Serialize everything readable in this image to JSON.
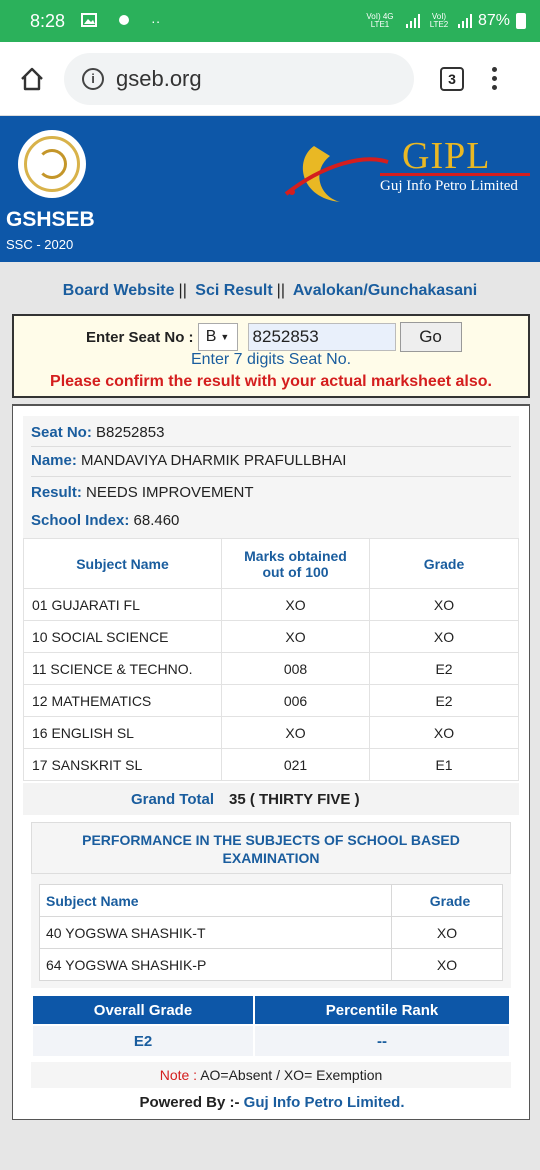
{
  "status_bar": {
    "time": "8:28",
    "signal1_label": "VoI) 4G LTE1",
    "signal2_label": "VoI) LTE2",
    "battery": "87%"
  },
  "browser": {
    "url": "gseb.org",
    "tab_count": "3"
  },
  "header": {
    "board_name": "GSHSEB",
    "exam": "SSC - 2020",
    "partner_title": "GIPL",
    "partner_subtitle": "Guj Info Petro Limited"
  },
  "links": [
    {
      "label": "Board Website"
    },
    {
      "label": "Sci Result"
    },
    {
      "label": "Avalokan/Gunchakasani"
    }
  ],
  "seat_form": {
    "label": "Enter Seat No :",
    "series_value": "B",
    "seat_value": "8252853",
    "go_label": "Go",
    "hint": "Enter 7 digits Seat No.",
    "warning": "Please confirm the result with your actual marksheet also."
  },
  "result": {
    "seat_no_label": "Seat No:",
    "seat_no": "B8252853",
    "name_label": "Name:",
    "name": "MANDAVIYA DHARMIK PRAFULLBHAI",
    "result_label": "Result:",
    "result": "NEEDS IMPROVEMENT",
    "school_index_label": "School Index:",
    "school_index": "68.460",
    "table_headers": {
      "subject": "Subject Name",
      "marks": "Marks obtained out of 100",
      "grade": "Grade"
    },
    "subjects": [
      {
        "name": "01 GUJARATI FL",
        "marks": "XO",
        "grade": "XO"
      },
      {
        "name": "10 SOCIAL SCIENCE",
        "marks": "XO",
        "grade": "XO"
      },
      {
        "name": "11 SCIENCE & TECHNO.",
        "marks": "008",
        "grade": "E2"
      },
      {
        "name": "12 MATHEMATICS",
        "marks": "006",
        "grade": "E2"
      },
      {
        "name": "16 ENGLISH SL",
        "marks": "XO",
        "grade": "XO"
      },
      {
        "name": "17 SANSKRIT SL",
        "marks": "021",
        "grade": "E1"
      }
    ],
    "grand_total_label": "Grand Total",
    "grand_total": "35 ( THIRTY FIVE )"
  },
  "school_based": {
    "title": "PERFORMANCE IN THE SUBJECTS OF SCHOOL BASED EXAMINATION",
    "headers": {
      "subject": "Subject Name",
      "grade": "Grade"
    },
    "subjects": [
      {
        "name": "40 YOGSWA SHASHIK-T",
        "grade": "XO"
      },
      {
        "name": "64 YOGSWA SHASHIK-P",
        "grade": "XO"
      }
    ]
  },
  "overall": {
    "grade_label": "Overall Grade",
    "rank_label": "Percentile Rank",
    "grade": "E2",
    "rank": "--"
  },
  "note": {
    "label": "Note :",
    "text": "AO=Absent / XO= Exemption"
  },
  "footer": {
    "label": "Powered By :-",
    "value": "Guj Info Petro Limited."
  },
  "colors": {
    "status_bar": "#2bb15b",
    "brand_blue": "#0d57a8",
    "link_blue": "#1a5d9e",
    "warning_red": "#d41e1e",
    "gold": "#e9b824"
  }
}
